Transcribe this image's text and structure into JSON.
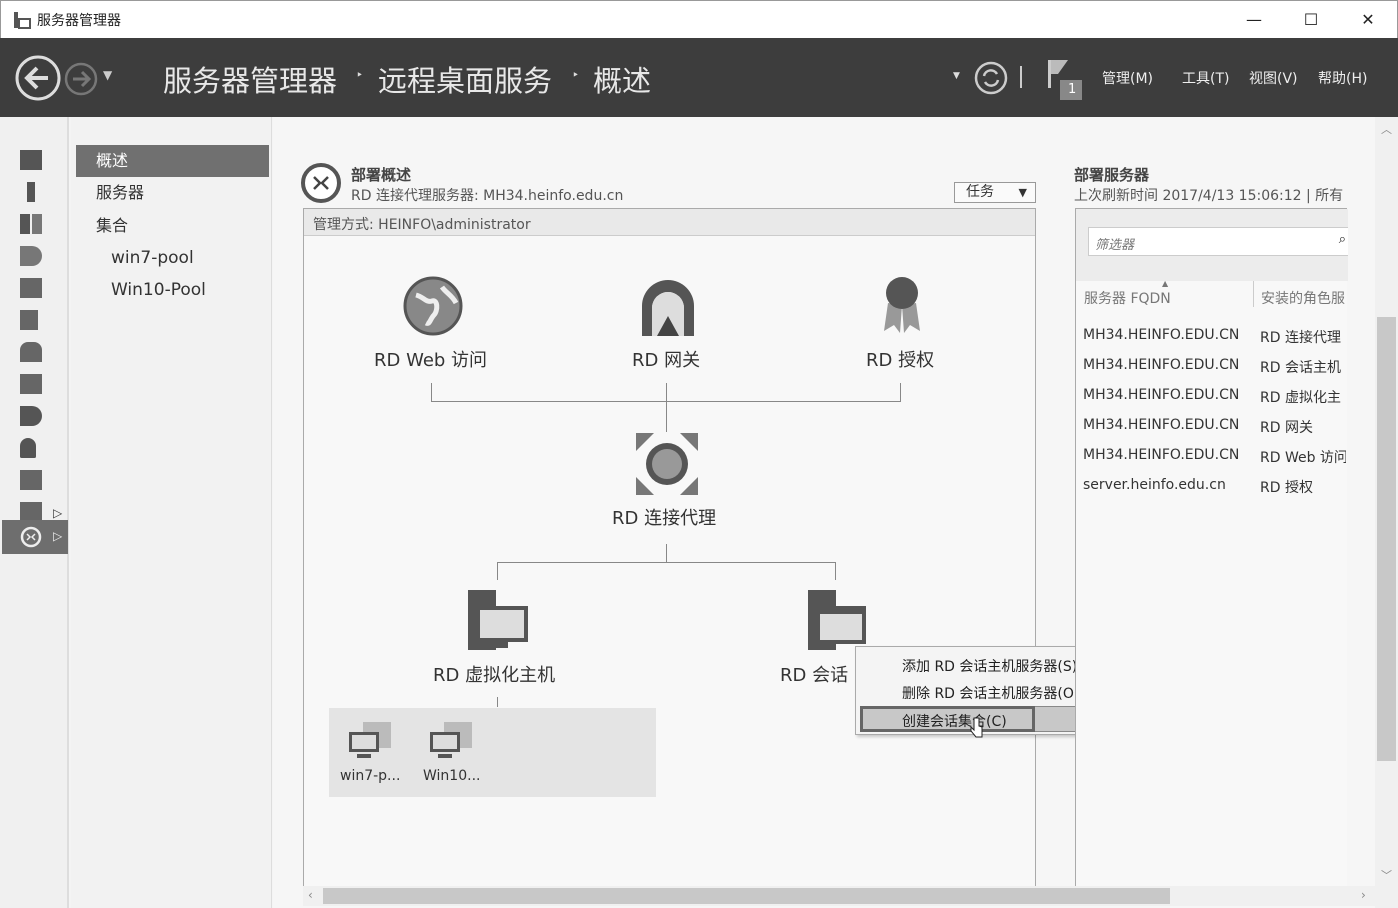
{
  "window": {
    "title": "服务器管理器",
    "minimize": "—",
    "maximize": "☐",
    "close": "✕"
  },
  "header": {
    "breadcrumb": [
      "服务器管理器",
      "远程桌面服务",
      "概述"
    ],
    "separator": "‣",
    "notification_count": "1",
    "menus": [
      "管理(M)",
      "工具(T)",
      "视图(V)",
      "帮助(H)"
    ]
  },
  "strip_icons": [
    "dashboard-icon",
    "local-server-icon",
    "all-servers-icon",
    "ad-cs-icon",
    "file-storage-icon",
    "iis-icon",
    "network-policy-icon",
    "print-icon",
    "rds-icon",
    "key-icon",
    "wsus-icon",
    "file-services-icon",
    "remote-desktop-icon"
  ],
  "nav": {
    "items": [
      "概述",
      "服务器",
      "集合"
    ],
    "sub": [
      "win7-pool",
      "Win10-Pool"
    ]
  },
  "overview": {
    "title": "部署概述",
    "subtitle": "RD 连接代理服务器: MH34.heinfo.edu.cn",
    "tasks": "任务",
    "managed_by": "管理方式: HEINFO\\administrator",
    "roles": {
      "web": "RD Web 访问",
      "gateway": "RD 网关",
      "licensing": "RD 授权",
      "broker": "RD 连接代理",
      "virtualization": "RD 虚拟化主机",
      "session": "RD 会话"
    },
    "pools": [
      "win7-p...",
      "Win10..."
    ]
  },
  "context_menu": [
    "添加 RD 会话主机服务器(S)",
    "删除 RD 会话主机服务器(O)",
    "创建会话集合(C)"
  ],
  "servers": {
    "title": "部署服务器",
    "refresh": "上次刷新时间 2017/4/13 15:06:12 | 所有",
    "filter_placeholder": "筛选器",
    "columns": [
      "服务器 FQDN",
      "安装的角色服"
    ],
    "rows": [
      [
        "MH34.HEINFO.EDU.CN",
        "RD 连接代理"
      ],
      [
        "MH34.HEINFO.EDU.CN",
        "RD 会话主机"
      ],
      [
        "MH34.HEINFO.EDU.CN",
        "RD 虚拟化主"
      ],
      [
        "MH34.HEINFO.EDU.CN",
        "RD 网关"
      ],
      [
        "MH34.HEINFO.EDU.CN",
        "RD Web 访问"
      ],
      [
        "server.heinfo.edu.cn",
        "RD 授权"
      ]
    ]
  }
}
